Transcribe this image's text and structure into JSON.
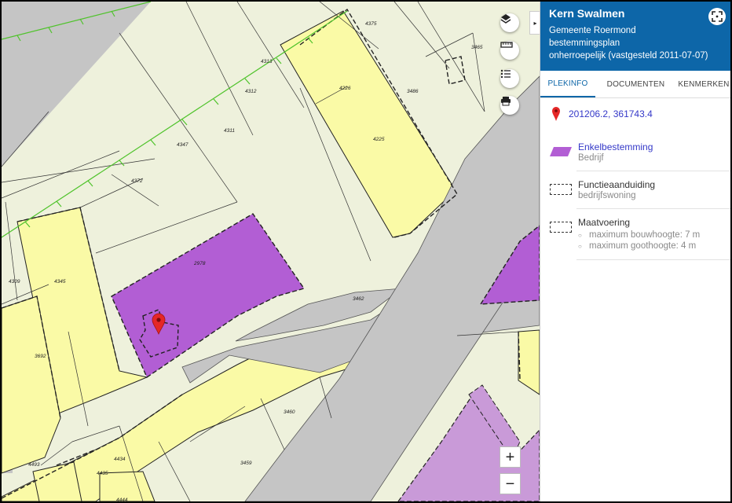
{
  "map": {
    "parcel_labels": [
      "4375",
      "3465",
      "4313",
      "4226",
      "3486",
      "4312",
      "4311",
      "4225",
      "4347",
      "4372",
      "2978",
      "3462",
      "4309",
      "4345",
      "3692",
      "3460",
      "4493",
      "4434",
      "4435",
      "3459",
      "4444"
    ],
    "colors": {
      "background": "#eef1dc",
      "residential": "#fafaa6",
      "business": "#b25ed4",
      "business_light": "#c99ad8",
      "road": "#c5c5c5",
      "railway": "#4fc32b",
      "pin": "#e52727"
    },
    "controls": {
      "layers_icon": "layers-icon",
      "measure_icon": "ruler-icon",
      "legend_icon": "list-icon",
      "print_icon": "printer-icon",
      "zoom_in": "+",
      "zoom_out": "−",
      "collapse": "▸"
    }
  },
  "panel": {
    "title": "Kern Swalmen",
    "municipality": "Gemeente Roermond",
    "plan_type": "bestemmingsplan",
    "status": "onherroepelijk (vastgesteld 2011-07-07)",
    "tabs": [
      "PLEKINFO",
      "DOCUMENTEN",
      "KENMERKEN"
    ],
    "active_tab": "PLEKINFO",
    "coordinates": "201206.2, 361743.4",
    "enkelbestemming": {
      "title": "Enkelbestemming",
      "value": "Bedrijf",
      "color": "#b25ed4"
    },
    "functieaanduiding": {
      "title": "Functieaanduiding",
      "value": "bedrijfswoning"
    },
    "maatvoering": {
      "title": "Maatvoering",
      "items": [
        "maximum bouwhoogte: 7 m",
        "maximum goothoogte: 4 m"
      ]
    }
  }
}
